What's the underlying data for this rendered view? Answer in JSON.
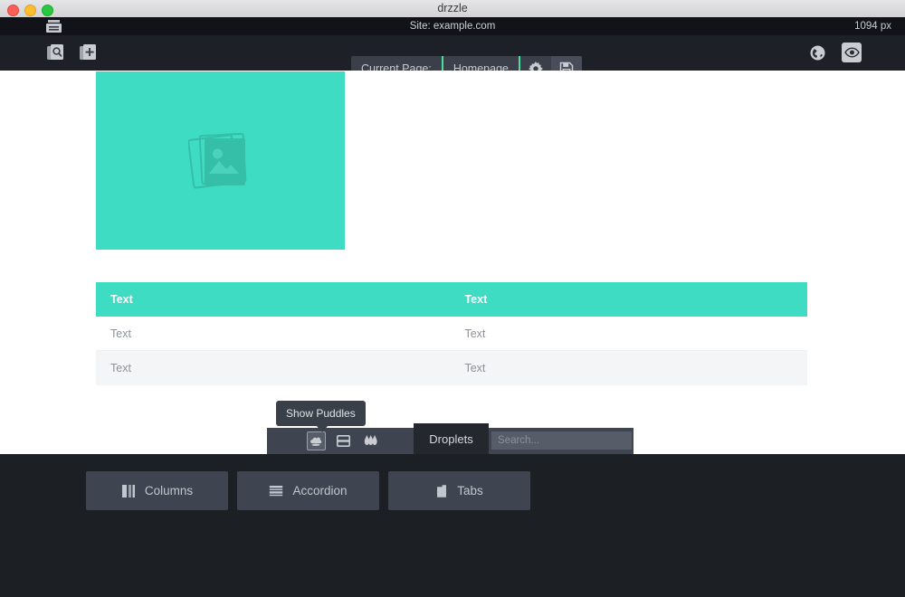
{
  "window": {
    "title": "drzzle",
    "traffic_lights": [
      "close",
      "minimize",
      "maximize"
    ],
    "colors": {
      "close": "#ff5f57",
      "minimize": "#febc2e",
      "maximize": "#28c840",
      "accent_teal": "#3ddcc3",
      "accent_green": "#4adf9f",
      "panel_dark": "#1c1f24",
      "panel_mid": "#3e4450"
    }
  },
  "sitebar": {
    "drawer_icon": "drawer-icon",
    "site_label": "Site: example.com",
    "viewport_size": "1094 px"
  },
  "toolbar": {
    "left_icons": [
      {
        "name": "inspect-page-icon",
        "title": "Inspect Page"
      },
      {
        "name": "add-page-icon",
        "title": "Add Page"
      }
    ],
    "page_selector": {
      "label": "Current Page:",
      "value": "Homepage",
      "settings_icon": "gear-icon",
      "save_icon": "save-icon"
    },
    "right_icons": [
      {
        "name": "globe-icon",
        "title": "Publish"
      },
      {
        "name": "eye-icon",
        "title": "Preview",
        "active": true
      }
    ]
  },
  "canvas": {
    "hero": {
      "placeholder_icon": "image-placeholder-icon"
    },
    "table": {
      "headers": [
        "Text",
        "Text"
      ],
      "rows": [
        [
          "Text",
          "Text"
        ],
        [
          "Text",
          "Text"
        ]
      ]
    }
  },
  "tooltip": {
    "text": "Show Puddles"
  },
  "panel": {
    "view_icons": [
      {
        "name": "puddles-icon",
        "active": true
      },
      {
        "name": "split-rows-icon",
        "active": false
      },
      {
        "name": "droplets-icon",
        "active": false
      }
    ],
    "tab_label": "Droplets",
    "search": {
      "value": "",
      "placeholder": "Search..."
    },
    "droplets": [
      {
        "label": "Columns",
        "icon": "columns-icon"
      },
      {
        "label": "Accordion",
        "icon": "accordion-icon"
      },
      {
        "label": "Tabs",
        "icon": "tabs-icon"
      }
    ]
  }
}
